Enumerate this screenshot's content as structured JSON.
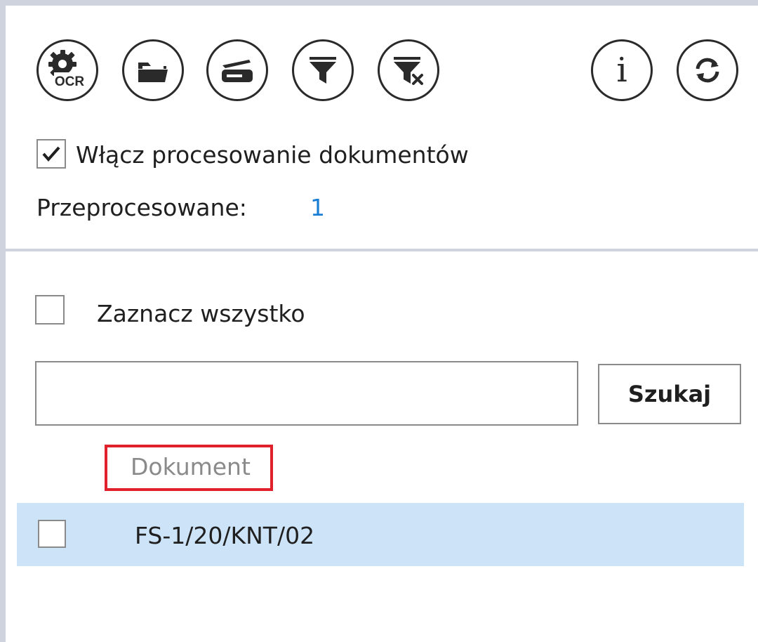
{
  "toolbar": {
    "buttons": [
      {
        "name": "ocr-settings",
        "icon": "gear-ocr-icon",
        "label": "OCR"
      },
      {
        "name": "open-folder",
        "icon": "folder-icon"
      },
      {
        "name": "scanner",
        "icon": "scanner-icon"
      },
      {
        "name": "filter",
        "icon": "filter-icon"
      },
      {
        "name": "clear-filter",
        "icon": "filter-clear-icon"
      },
      {
        "name": "info",
        "icon": "info-icon",
        "label": "i"
      },
      {
        "name": "refresh",
        "icon": "refresh-icon"
      }
    ]
  },
  "processing": {
    "enable_label": "Włącz procesowanie dokumentów",
    "enabled": true,
    "processed_label": "Przeprocesowane:",
    "processed_count": "1"
  },
  "list": {
    "select_all_label": "Zaznacz wszystko",
    "search": {
      "value": "",
      "placeholder": "",
      "button_label": "Szukaj"
    },
    "column_header": "Dokument",
    "rows": [
      {
        "document": "FS-1/20/KNT/02",
        "checked": false,
        "selected": true
      }
    ]
  },
  "colors": {
    "accent_number": "#1a7fd4",
    "row_selected": "#cde3f7",
    "header_highlight": "#e0202a",
    "frame": "#cfd3de"
  }
}
